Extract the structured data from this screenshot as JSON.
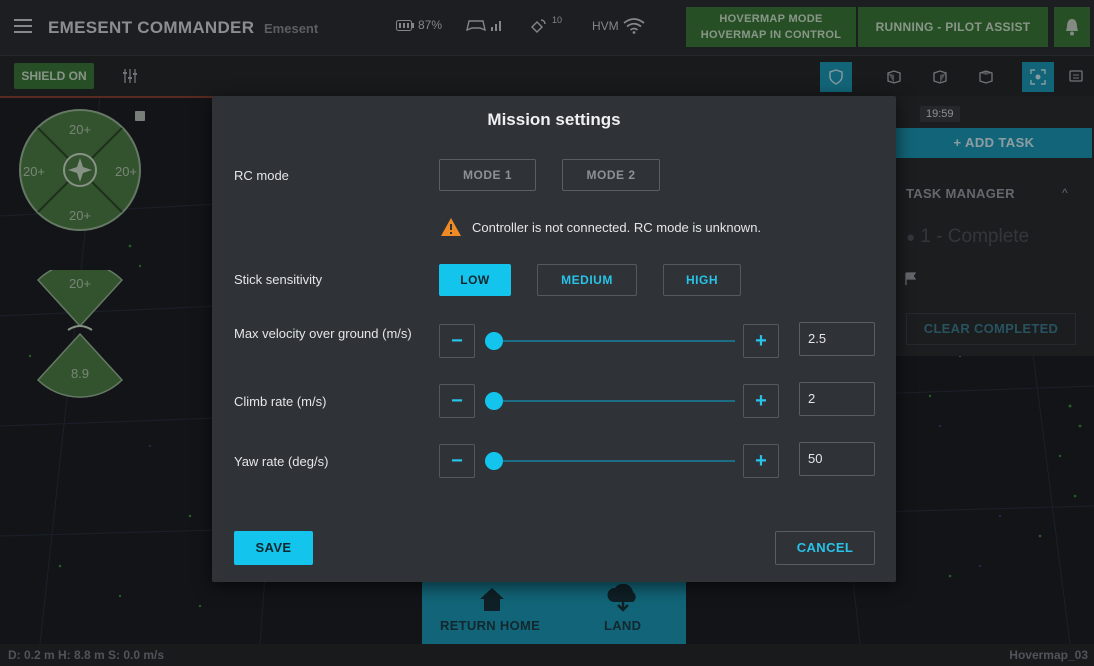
{
  "header": {
    "app_title": "EMESENT COMMANDER",
    "app_subtitle": "Emesent",
    "battery": "87%",
    "signal_sub": "10",
    "hvm_label": "HVM",
    "mode_line1": "HOVERMAP MODE",
    "mode_line2": "HOVERMAP IN CONTROL",
    "status": "RUNNING - PILOT ASSIST",
    "status_color": "#3d7a3a"
  },
  "toolbar": {
    "shield_label": "SHIELD ON",
    "accent_color": "#1d9bb8"
  },
  "widgets": {
    "compass_top": "20+",
    "compass_left": "20+",
    "compass_right": "20+",
    "compass_bottom": "20+",
    "speed_top": "20+",
    "speed_bottom": "8.9"
  },
  "task_panel": {
    "time": "19:59",
    "add_task": "+ ADD TASK",
    "title": "TASK MANAGER",
    "item": "1 - Complete",
    "clear_completed": "CLEAR COMPLETED"
  },
  "bottom_panel": {
    "return_home": "RETURN HOME",
    "land": "LAND"
  },
  "statusbar": {
    "left": "D: 0.2 m  H: 8.8 m  S: 0.0 m/s",
    "right": "Hovermap_03"
  },
  "dialog": {
    "title": "Mission settings",
    "rc_mode_label": "RC mode",
    "rc_mode_options": [
      "MODE 1",
      "MODE 2"
    ],
    "warning": "Controller is not connected. RC mode is unknown.",
    "stick_label": "Stick sensitivity",
    "stick_options": [
      "LOW",
      "MEDIUM",
      "HIGH"
    ],
    "stick_selected": "LOW",
    "max_velocity_label": "Max velocity over ground (m/s)",
    "max_velocity_value": "2.5",
    "climb_label": "Climb rate (m/s)",
    "climb_value": "2",
    "yaw_label": "Yaw rate (deg/s)",
    "yaw_value": "50",
    "save": "SAVE",
    "cancel": "CANCEL"
  }
}
